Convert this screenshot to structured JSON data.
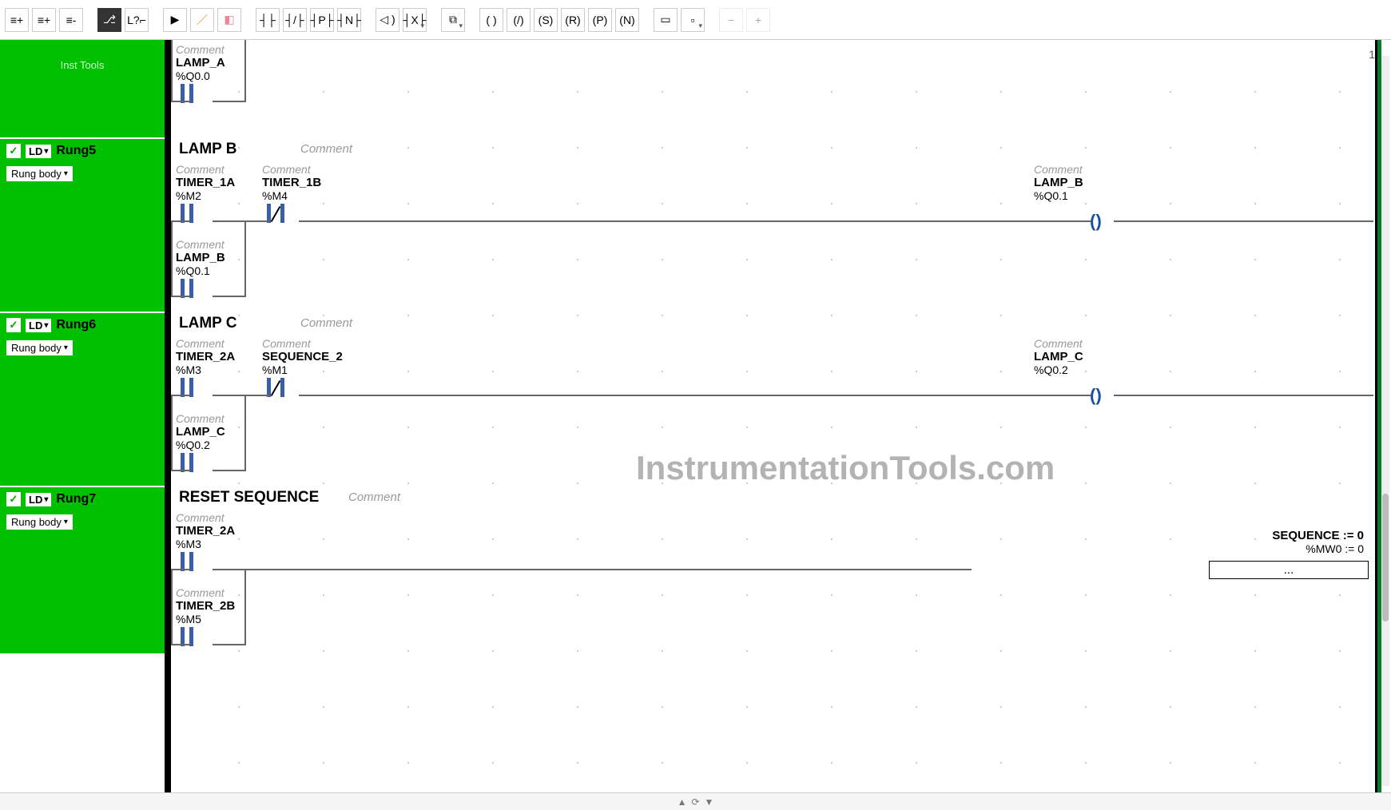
{
  "page_number": "1",
  "watermark": "InstrumentationTools.com",
  "toolbar": {
    "buttons": [
      {
        "name": "insert-rung-above-icon",
        "glyph": "≡+"
      },
      {
        "name": "insert-rung-below-icon",
        "glyph": "≡+"
      },
      {
        "name": "delete-rung-icon",
        "glyph": "≡-"
      },
      {
        "name": "branch-mode-icon",
        "glyph": "⎇",
        "dark": true
      },
      {
        "name": "label-mode-icon",
        "glyph": "L?⌐"
      },
      {
        "name": "pointer-icon",
        "glyph": "▶"
      },
      {
        "name": "draw-line-icon",
        "glyph": "／",
        "color": "#d98a00"
      },
      {
        "name": "eraser-icon",
        "glyph": "◧",
        "color": "#e89"
      },
      {
        "name": "no-contact-icon",
        "glyph": "┤├"
      },
      {
        "name": "nc-contact-icon",
        "glyph": "┤/├"
      },
      {
        "name": "rising-contact-icon",
        "glyph": "┤P├"
      },
      {
        "name": "falling-contact-icon",
        "glyph": "┤N├"
      },
      {
        "name": "coil-icon",
        "glyph": "◁ )"
      },
      {
        "name": "not-coil-icon",
        "glyph": "┤X├",
        "dd": true
      },
      {
        "name": "compare-block-icon",
        "glyph": "⧉",
        "dd": true
      },
      {
        "name": "xic-icon",
        "glyph": "( )"
      },
      {
        "name": "xio-icon",
        "glyph": "(/)"
      },
      {
        "name": "set-coil-icon",
        "glyph": "(S)"
      },
      {
        "name": "reset-coil-icon",
        "glyph": "(R)"
      },
      {
        "name": "pos-coil-icon",
        "glyph": "(P)"
      },
      {
        "name": "neg-coil-icon",
        "glyph": "(N)"
      },
      {
        "name": "operate-block-icon",
        "glyph": "▭"
      },
      {
        "name": "function-block-icon",
        "glyph": "▫",
        "dd": true
      },
      {
        "name": "zoom-out-icon",
        "glyph": "−",
        "faded": true
      },
      {
        "name": "zoom-in-icon",
        "glyph": "+",
        "faded": true
      }
    ]
  },
  "left": {
    "inst_tools": "Inst Tools",
    "ld": "LD",
    "rung_body": "Rung body",
    "rungs": [
      {
        "name": "Rung5"
      },
      {
        "name": "Rung6"
      },
      {
        "name": "Rung7"
      }
    ]
  },
  "common": {
    "comment": "Comment"
  },
  "rung_top": {
    "branch2": {
      "name": "LAMP_A",
      "addr": "%Q0.0"
    }
  },
  "rung5": {
    "title": "LAMP B",
    "in1": {
      "name": "TIMER_1A",
      "addr": "%M2"
    },
    "in2": {
      "name": "TIMER_1B",
      "addr": "%M4"
    },
    "br": {
      "name": "LAMP_B",
      "addr": "%Q0.1"
    },
    "out": {
      "name": "LAMP_B",
      "addr": "%Q0.1"
    }
  },
  "rung6": {
    "title": "LAMP C",
    "in1": {
      "name": "TIMER_2A",
      "addr": "%M3"
    },
    "in2": {
      "name": "SEQUENCE_2",
      "addr": "%M1"
    },
    "br": {
      "name": "LAMP_C",
      "addr": "%Q0.2"
    },
    "out": {
      "name": "LAMP_C",
      "addr": "%Q0.2"
    }
  },
  "rung7": {
    "title": "RESET SEQUENCE",
    "in1": {
      "name": "TIMER_2A",
      "addr": "%M3"
    },
    "br": {
      "name": "TIMER_2B",
      "addr": "%M5"
    },
    "op": {
      "line1": "SEQUENCE := 0",
      "line2": "%MW0 := 0",
      "ellipsis": "..."
    }
  },
  "footer": {
    "up": "▲",
    "refresh": "⟳",
    "down": "▼"
  }
}
